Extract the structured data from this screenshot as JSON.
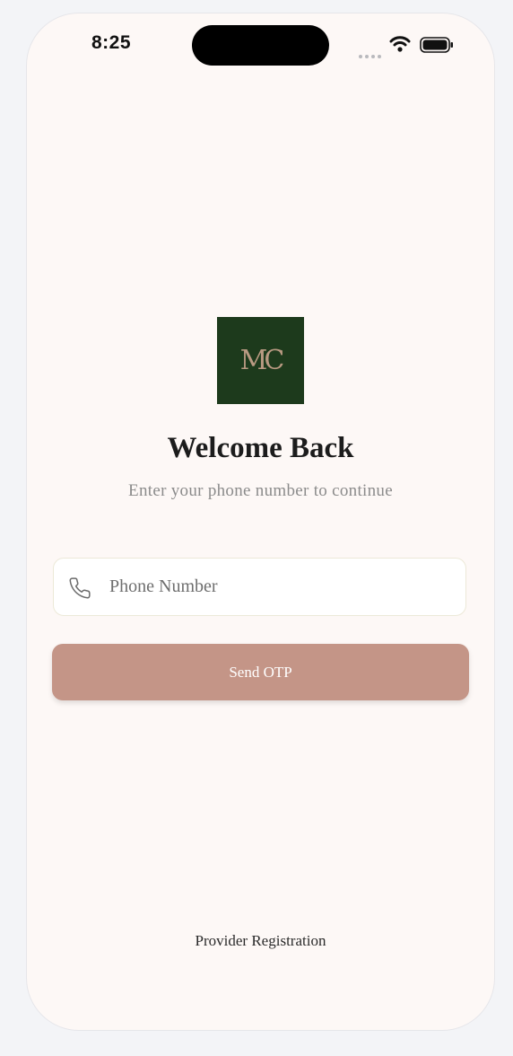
{
  "status_bar": {
    "time": "8:25",
    "signal_icon": "cellular-dots-icon",
    "wifi_icon": "wifi-icon",
    "battery_icon": "battery-icon"
  },
  "logo": {
    "text": "MC",
    "background": "#1d3a1c",
    "text_color": "#b99a82"
  },
  "header": {
    "title": "Welcome Back",
    "subtitle": "Enter your phone number to continue"
  },
  "form": {
    "phone_icon": "phone-icon",
    "phone_value": "",
    "phone_placeholder": "Phone Number",
    "send_label": "Send OTP",
    "button_color": "#c49587"
  },
  "footer": {
    "provider_link": "Provider Registration"
  },
  "colors": {
    "screen_background": "#fdf8f6",
    "page_background": "#f3f4f7"
  }
}
